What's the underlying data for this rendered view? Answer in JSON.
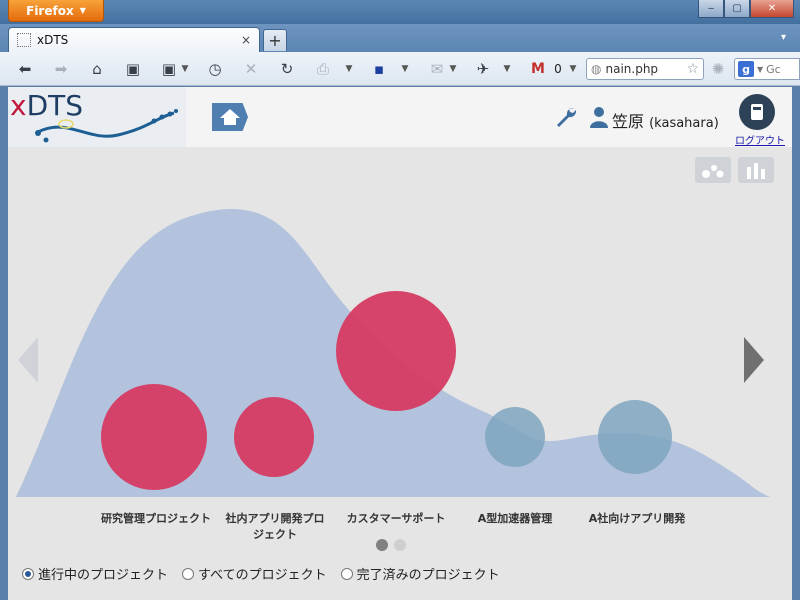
{
  "browser": {
    "menu_button": "Firefox",
    "win_minimize": "‒",
    "win_maximize": "▢",
    "win_close": "✕",
    "tab_title": "xDTS",
    "tab_close": "×",
    "new_tab": "+",
    "tab_list": "▾",
    "url": "nain.php",
    "gmail_count": "0",
    "search_placeholder": "Gc",
    "icons": [
      "back-icon",
      "forward-icon",
      "home-icon",
      "bookmark-icon",
      "bookmarks-menu-icon",
      "history-icon",
      "stop-icon",
      "reload-icon",
      "print-icon",
      "save-icon",
      "mail-icon",
      "addon-icon",
      "gmail-icon",
      "globe-icon",
      "star-icon",
      "sync-icon",
      "google-icon"
    ]
  },
  "app": {
    "logo": {
      "x": "x",
      "rest": "DTS"
    },
    "user_name": "笠原",
    "user_id": "(kasahara)",
    "logout_label": "ログアウト",
    "colors": {
      "active": "#d63b62",
      "done": "#7fa6bf",
      "area": "#b3c3dd",
      "home": "#4e7fb0"
    }
  },
  "chart_data": {
    "type": "bubble",
    "title": "",
    "background_area": "distribution-curve",
    "categories": [
      "研究管理プロジェクト",
      "社内アプリ開発プロジェクト",
      "カスタマーサポート",
      "A型加速器管理",
      "A社向けアプリ開発"
    ],
    "label_lines": [
      [
        "研究管理プロジェクト"
      ],
      [
        "社内アプリ開発プロ",
        "ジェクト"
      ],
      [
        "カスタマーサポート"
      ],
      [
        "A型加速器管理"
      ],
      [
        "A社向けアプリ開発"
      ]
    ],
    "series": [
      {
        "status": "active",
        "categories": [
          "研究管理プロジェクト",
          "社内アプリ開発プロジェクト",
          "カスタマーサポート"
        ]
      },
      {
        "status": "done",
        "categories": [
          "A型加速器管理",
          "A社向けアプリ開発"
        ]
      }
    ],
    "size_values": [
      53,
      40,
      60,
      30,
      37
    ],
    "level_values": [
      0.0,
      0.0,
      0.43,
      0.0,
      0.0
    ]
  },
  "pagination": {
    "pages": 2,
    "current": 1
  },
  "filters": [
    {
      "label": "進行中のプロジェクト",
      "selected": true
    },
    {
      "label": "すべてのプロジェクト",
      "selected": false
    },
    {
      "label": "完了済みのプロジェクト",
      "selected": false
    }
  ]
}
